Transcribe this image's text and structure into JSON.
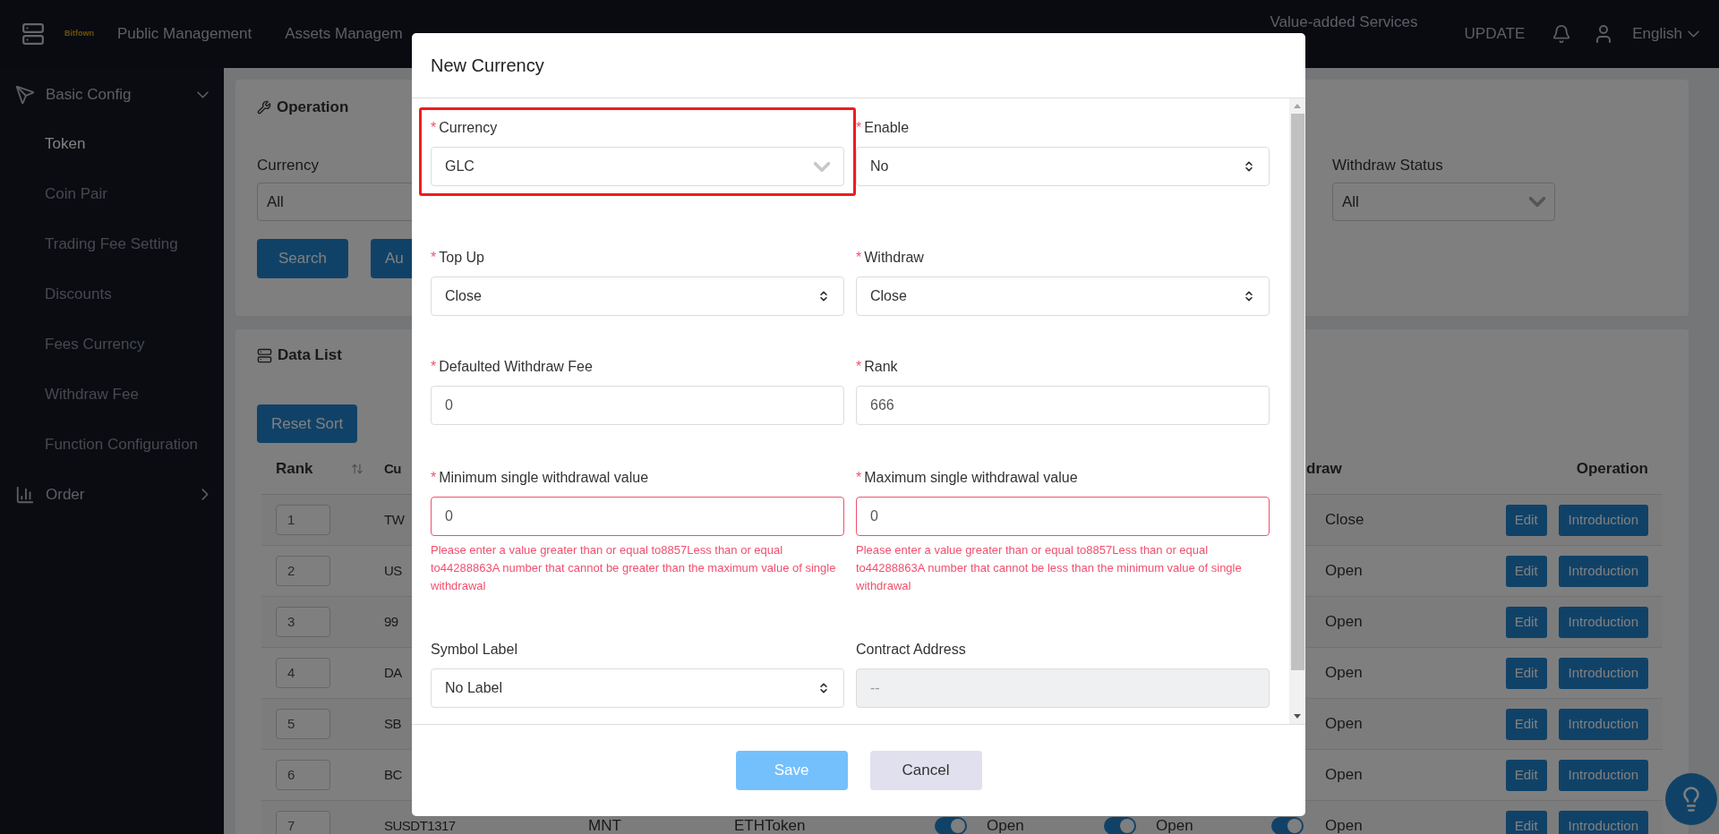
{
  "top_nav": {
    "brand": "Bitfown",
    "items": [
      {
        "label": "Public Management"
      },
      {
        "label": "Assets Managem"
      }
    ],
    "right_items": [
      {
        "label": "Value-added Services"
      }
    ],
    "update": "UPDATE",
    "language": "English"
  },
  "sidebar": {
    "groups": [
      {
        "label": "Basic Config",
        "expanded": true,
        "children": [
          {
            "label": "Token",
            "selected": true
          },
          {
            "label": "Coin Pair",
            "selected": false
          },
          {
            "label": "Trading Fee Setting",
            "selected": false
          },
          {
            "label": "Discounts",
            "selected": false
          },
          {
            "label": "Fees Currency",
            "selected": false
          },
          {
            "label": "Withdraw Fee",
            "selected": false
          },
          {
            "label": "Function Configuration",
            "selected": false
          }
        ]
      },
      {
        "label": "Order",
        "expanded": false
      }
    ]
  },
  "operation_panel": {
    "title": "Operation",
    "currency_label": "Currency",
    "currency_value": "All",
    "buttons": [
      "Search",
      "Au"
    ],
    "withdraw_status_label": "Withdraw Status",
    "withdraw_status_value": "All"
  },
  "data_list": {
    "title": "Data List",
    "reset_button": "Reset Sort",
    "columns": {
      "rank": "Rank",
      "currency": "Cu",
      "withdraw": "draw",
      "operation": "Operation"
    },
    "rows": [
      {
        "rank": "1",
        "currency": "TW",
        "withdraw": {
          "label": "Close"
        },
        "edit": "Edit",
        "introduction": "Introduction"
      },
      {
        "rank": "2",
        "currency": "US",
        "withdraw": {
          "label": "Open"
        },
        "edit": "Edit",
        "introduction": "Introduction"
      },
      {
        "rank": "3",
        "currency": "99",
        "withdraw": {
          "label": "Open"
        },
        "edit": "Edit",
        "introduction": "Introduction"
      },
      {
        "rank": "4",
        "currency": "DA",
        "withdraw": {
          "label": "Open"
        },
        "edit": "Edit",
        "introduction": "Introduction"
      },
      {
        "rank": "5",
        "currency": "SB",
        "withdraw": {
          "label": "Open"
        },
        "edit": "Edit",
        "introduction": "Introduction"
      },
      {
        "rank": "6",
        "currency": "BC",
        "withdraw": {
          "label": "Open"
        },
        "edit": "Edit",
        "introduction": "Introduction"
      },
      {
        "rank": "7",
        "currency": "SUSDT1317",
        "column_3": "MNT",
        "column_4": "ETHToken",
        "toggles": [
          {
            "on": true,
            "label": "Open"
          },
          {
            "on": true,
            "label": "Open"
          }
        ],
        "withdraw": {
          "on": true,
          "label": "Open"
        },
        "edit": "Edit",
        "introduction": "Introduction"
      }
    ]
  },
  "modal": {
    "title": "New Currency",
    "fields": [
      {
        "mark": "*",
        "label": "Currency",
        "kind": "dropdown",
        "value": "GLC",
        "highlighted": true
      },
      {
        "mark": "*",
        "label": "Enable",
        "kind": "select",
        "value": "No"
      },
      {
        "mark": "*",
        "label": "Top Up",
        "kind": "select",
        "value": "Close"
      },
      {
        "mark": "*",
        "label": "Withdraw",
        "kind": "select",
        "value": "Close"
      },
      {
        "mark": "*",
        "label": "Defaulted Withdraw Fee",
        "kind": "input",
        "value": "0"
      },
      {
        "mark": "*",
        "label": "Rank",
        "kind": "input",
        "value": "666"
      },
      {
        "mark": "*",
        "label": "Minimum single withdrawal value",
        "kind": "input",
        "value": "0",
        "error": "Please enter a value greater than or equal to8857Less than or equal to44288863A number that cannot be greater than the maximum value of single withdrawal"
      },
      {
        "mark": "*",
        "label": "Maximum single withdrawal value",
        "kind": "input",
        "value": "0",
        "error": "Please enter a value greater than or equal to8857Less than or equal to44288863A number that cannot be less than the minimum value of single withdrawal"
      },
      {
        "label": "Symbol Label",
        "kind": "select",
        "value": "No Label"
      },
      {
        "label": "Contract Address",
        "kind": "disabled",
        "placeholder": "--"
      }
    ],
    "save": "Save",
    "cancel": "Cancel"
  }
}
